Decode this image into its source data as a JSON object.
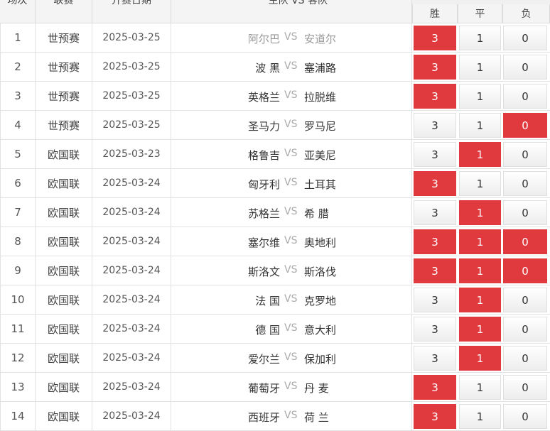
{
  "header": {
    "col_index": "场次",
    "col_league": "联赛",
    "col_date": "开赛日期",
    "col_match": "主队 VS 客队",
    "odds": {
      "win": "胜",
      "draw": "平",
      "lose": "负"
    }
  },
  "vs_label": "VS",
  "rows": [
    {
      "idx": "1",
      "league": "世预赛",
      "date": "2025-03-25",
      "home": "阿尔巴",
      "away": "安道尔",
      "win": "3",
      "draw": "1",
      "lose": "0",
      "hit": "win",
      "muted": true
    },
    {
      "idx": "2",
      "league": "世预赛",
      "date": "2025-03-25",
      "home": "波 黑",
      "away": "塞浦路",
      "win": "3",
      "draw": "1",
      "lose": "0",
      "hit": "win",
      "muted": false
    },
    {
      "idx": "3",
      "league": "世预赛",
      "date": "2025-03-25",
      "home": "英格兰",
      "away": "拉脱维",
      "win": "3",
      "draw": "1",
      "lose": "0",
      "hit": "win",
      "muted": false
    },
    {
      "idx": "4",
      "league": "世预赛",
      "date": "2025-03-25",
      "home": "圣马力",
      "away": "罗马尼",
      "win": "3",
      "draw": "1",
      "lose": "0",
      "hit": "lose",
      "muted": false
    },
    {
      "idx": "5",
      "league": "欧国联",
      "date": "2025-03-23",
      "home": "格鲁吉",
      "away": "亚美尼",
      "win": "3",
      "draw": "1",
      "lose": "0",
      "hit": "draw",
      "muted": false
    },
    {
      "idx": "6",
      "league": "欧国联",
      "date": "2025-03-24",
      "home": "匈牙利",
      "away": "土耳其",
      "win": "3",
      "draw": "1",
      "lose": "0",
      "hit": "win",
      "muted": false
    },
    {
      "idx": "7",
      "league": "欧国联",
      "date": "2025-03-24",
      "home": "苏格兰",
      "away": "希 腊",
      "win": "3",
      "draw": "1",
      "lose": "0",
      "hit": "draw",
      "muted": false
    },
    {
      "idx": "8",
      "league": "欧国联",
      "date": "2025-03-24",
      "home": "塞尔维",
      "away": "奥地利",
      "win": "3",
      "draw": "1",
      "lose": "0",
      "hit": "win,draw,lose",
      "muted": false
    },
    {
      "idx": "9",
      "league": "欧国联",
      "date": "2025-03-24",
      "home": "斯洛文",
      "away": "斯洛伐",
      "win": "3",
      "draw": "1",
      "lose": "0",
      "hit": "win,draw,lose",
      "muted": false
    },
    {
      "idx": "10",
      "league": "欧国联",
      "date": "2025-03-24",
      "home": "法 国",
      "away": "克罗地",
      "win": "3",
      "draw": "1",
      "lose": "0",
      "hit": "draw",
      "muted": false
    },
    {
      "idx": "11",
      "league": "欧国联",
      "date": "2025-03-24",
      "home": "德 国",
      "away": "意大利",
      "win": "3",
      "draw": "1",
      "lose": "0",
      "hit": "draw",
      "muted": false
    },
    {
      "idx": "12",
      "league": "欧国联",
      "date": "2025-03-24",
      "home": "爱尔兰",
      "away": "保加利",
      "win": "3",
      "draw": "1",
      "lose": "0",
      "hit": "draw",
      "muted": false
    },
    {
      "idx": "13",
      "league": "欧国联",
      "date": "2025-03-24",
      "home": "葡萄牙",
      "away": "丹 麦",
      "win": "3",
      "draw": "1",
      "lose": "0",
      "hit": "win",
      "muted": false
    },
    {
      "idx": "14",
      "league": "欧国联",
      "date": "2025-03-24",
      "home": "西班牙",
      "away": "荷 兰",
      "win": "3",
      "draw": "1",
      "lose": "0",
      "hit": "win",
      "muted": false
    }
  ],
  "colors": {
    "hit": "#e0393e",
    "header_bg": "#f4f4f4",
    "border": "#e2e2e2"
  }
}
